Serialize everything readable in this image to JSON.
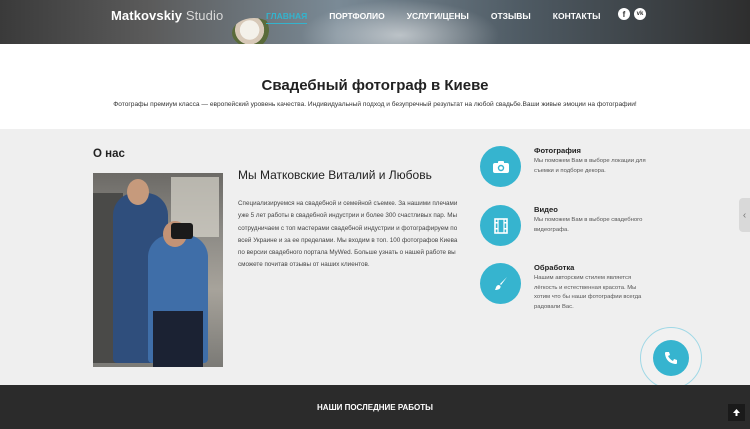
{
  "brand": {
    "bold": "Matkovskiy",
    "light": "Studio"
  },
  "nav": {
    "items": [
      {
        "label": "ГЛАВНАЯ"
      },
      {
        "label": "ПОРТФОЛИО"
      },
      {
        "label": "УСЛУГИ/ЦЕНЫ"
      },
      {
        "label": "ОТЗЫВЫ"
      },
      {
        "label": "КОНТАКТЫ"
      }
    ],
    "active": "ГЛАВНАЯ"
  },
  "social": {
    "facebook": "f",
    "vk": "vk"
  },
  "hero": {
    "title": "Свадебный фотограф в Киеве",
    "subtitle": "Фотографы премиум класса — европейский уровень качества. Индивидуальный подход и безупречный результат на любой свадьбе.Ваши живые эмоции на фотографии!"
  },
  "about": {
    "heading": "О нас",
    "title": "Мы Матковские Виталий и Любовь",
    "text": "Специализируемся на свадебной и семейной съемке. За нашими плечами уже 5 лет работы в свадебной индустрии и более 300 счастливых пар. Мы сотрудничаем с топ мастерами свадебной индустрии и фотографируем по всей Украине и за ее пределами. Мы входим в топ. 100 фотографов Киева по версии свадебного портала MyWed. Больше узнать о нашей работе вы сможете почитав отзывы от наших клиентов."
  },
  "services": [
    {
      "name": "Фотография",
      "desc": "Мы поможем Вам в выборе локации для съемки и подборе декора.",
      "icon": "camera-icon"
    },
    {
      "name": "Видео",
      "desc": "Мы поможем Вам в выборе свадебного видеографа.",
      "icon": "film-icon"
    },
    {
      "name": "Обработка",
      "desc": "Нашим авторским стилем является лёгкость и естественная красота. Мы хотим что бы наши фотографии всегда радовали Вас.",
      "icon": "brush-icon"
    }
  ],
  "footer": {
    "works_heading": "НАШИ ПОСЛЕДНИЕ РАБОТЫ"
  },
  "colors": {
    "accent": "#36b4cf",
    "dark": "#2b2b2b",
    "section_bg": "#efefef"
  }
}
